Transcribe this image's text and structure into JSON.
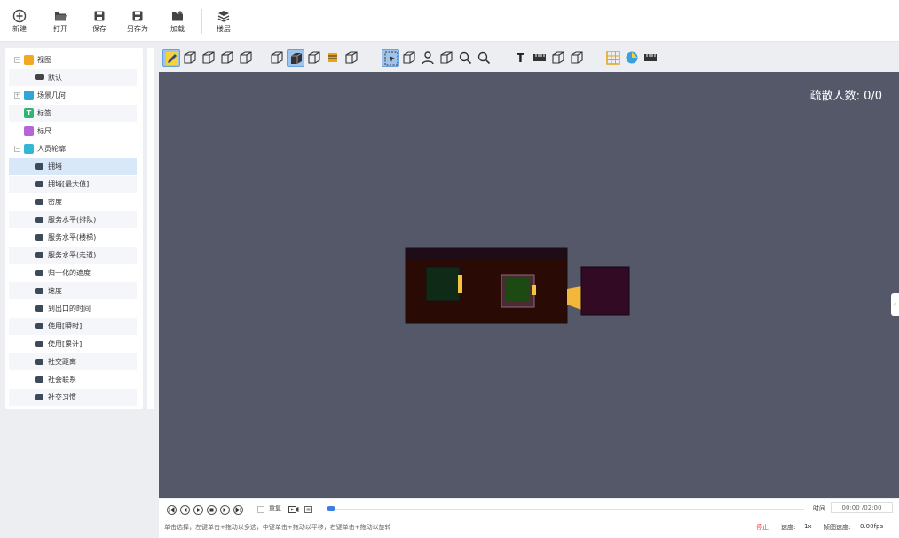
{
  "toolbar": {
    "new_label": "新建",
    "open_label": "打开",
    "save_label": "保存",
    "save_as_label": "另存为",
    "load_label": "加载",
    "floor_label": "楼层"
  },
  "tree": {
    "view": "视图",
    "default": "默认",
    "scene_geometry": "场景几何",
    "label": "标签",
    "ruler": "标尺",
    "person_outline": "人员轮廓",
    "items": [
      "拥堵",
      "拥堵[最大值]",
      "密度",
      "服务水平(排队)",
      "服务水平(楼梯)",
      "服务水平(走道)",
      "归一化的速度",
      "速度",
      "到出口的时间",
      "使用[瞬时]",
      "使用[累计]",
      "社交距离",
      "社会联系",
      "社交习惯"
    ]
  },
  "viewport": {
    "evac_label": "疏散人数: 0/0",
    "background": "#545869"
  },
  "playback": {
    "repeat_label": "重复",
    "time_label": "时间",
    "time_value": "00:00 /02:00",
    "hint": "单击选择，左键单击+拖动以多选，中键单击+拖动以平移，右键单击+拖动以旋转",
    "stop_label": "停止",
    "speed_label": "速度:",
    "speed_value": "1x",
    "fps_label": "帧图速度:",
    "fps_value": "0.00fps",
    "progress": 0.0
  },
  "colors": {
    "accent": "#3b7de0",
    "stop": "#e03030",
    "tree_selected": "#d9e8f8"
  }
}
